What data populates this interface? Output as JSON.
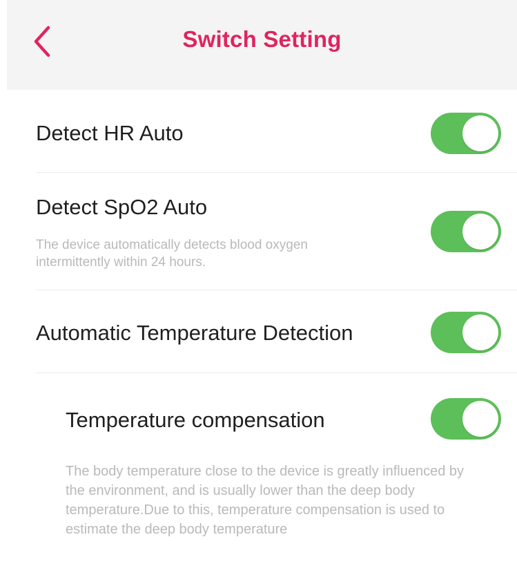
{
  "header": {
    "title": "Switch Setting",
    "back_icon": "chevron-left-icon",
    "accent_color": "#e0245e"
  },
  "settings": [
    {
      "label": "Detect HR Auto",
      "description": "",
      "enabled": true
    },
    {
      "label": "Detect SpO2 Auto",
      "description": "The device automatically detects blood oxygen intermittently within 24 hours.",
      "enabled": true
    },
    {
      "label": "Automatic Temperature Detection",
      "description": "",
      "enabled": true
    },
    {
      "label": "Temperature compensation",
      "description": "The body temperature close to the device is greatly influenced by the environment, and is usually lower than the deep body temperature.Due to this, temperature compensation is used to estimate the deep body temperature",
      "enabled": true
    }
  ],
  "colors": {
    "toggle_on": "#5dbf5a",
    "header_bg": "#f5f4f4",
    "description_text": "#b9b9b9"
  }
}
